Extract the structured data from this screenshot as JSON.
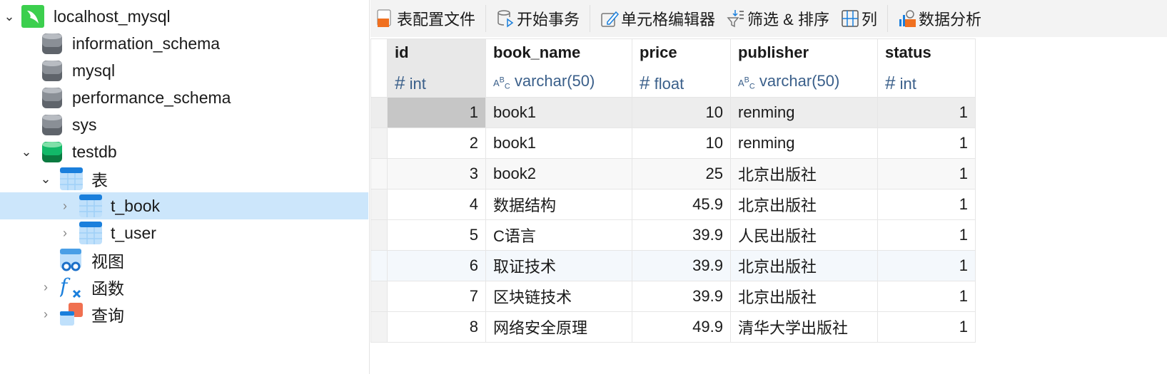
{
  "sidebar": {
    "connection": "localhost_mysql",
    "databases": [
      "information_schema",
      "mysql",
      "performance_schema",
      "sys",
      "testdb"
    ],
    "tables_group": "表",
    "tables": [
      "t_book",
      "t_user"
    ],
    "views": "视图",
    "functions": "函数",
    "queries": "查询"
  },
  "toolbar": {
    "table_profile": "表配置文件",
    "begin_transaction": "开始事务",
    "cell_editor": "单元格编辑器",
    "filter_sort": "筛选 & 排序",
    "columns": "列",
    "data_analysis": "数据分析"
  },
  "grid": {
    "columns": [
      {
        "name": "id",
        "type": "int",
        "type_icon": "#"
      },
      {
        "name": "book_name",
        "type": "varchar(50)",
        "type_icon": "ABC"
      },
      {
        "name": "price",
        "type": "float",
        "type_icon": "#"
      },
      {
        "name": "publisher",
        "type": "varchar(50)",
        "type_icon": "ABC"
      },
      {
        "name": "status",
        "type": "int",
        "type_icon": "#"
      }
    ],
    "rows": [
      [
        "1",
        "book1",
        "10",
        "renming",
        "1"
      ],
      [
        "2",
        "book1",
        "10",
        "renming",
        "1"
      ],
      [
        "3",
        "book2",
        "25",
        "北京出版社",
        "1"
      ],
      [
        "4",
        "数据结构",
        "45.9",
        "北京出版社",
        "1"
      ],
      [
        "5",
        "C语言",
        "39.9",
        "人民出版社",
        "1"
      ],
      [
        "6",
        "取证技术",
        "39.9",
        "北京出版社",
        "1"
      ],
      [
        "7",
        "区块链技术",
        "39.9",
        "北京出版社",
        "1"
      ],
      [
        "8",
        "网络安全原理",
        "49.9",
        "清华大学出版社",
        "1"
      ]
    ]
  }
}
